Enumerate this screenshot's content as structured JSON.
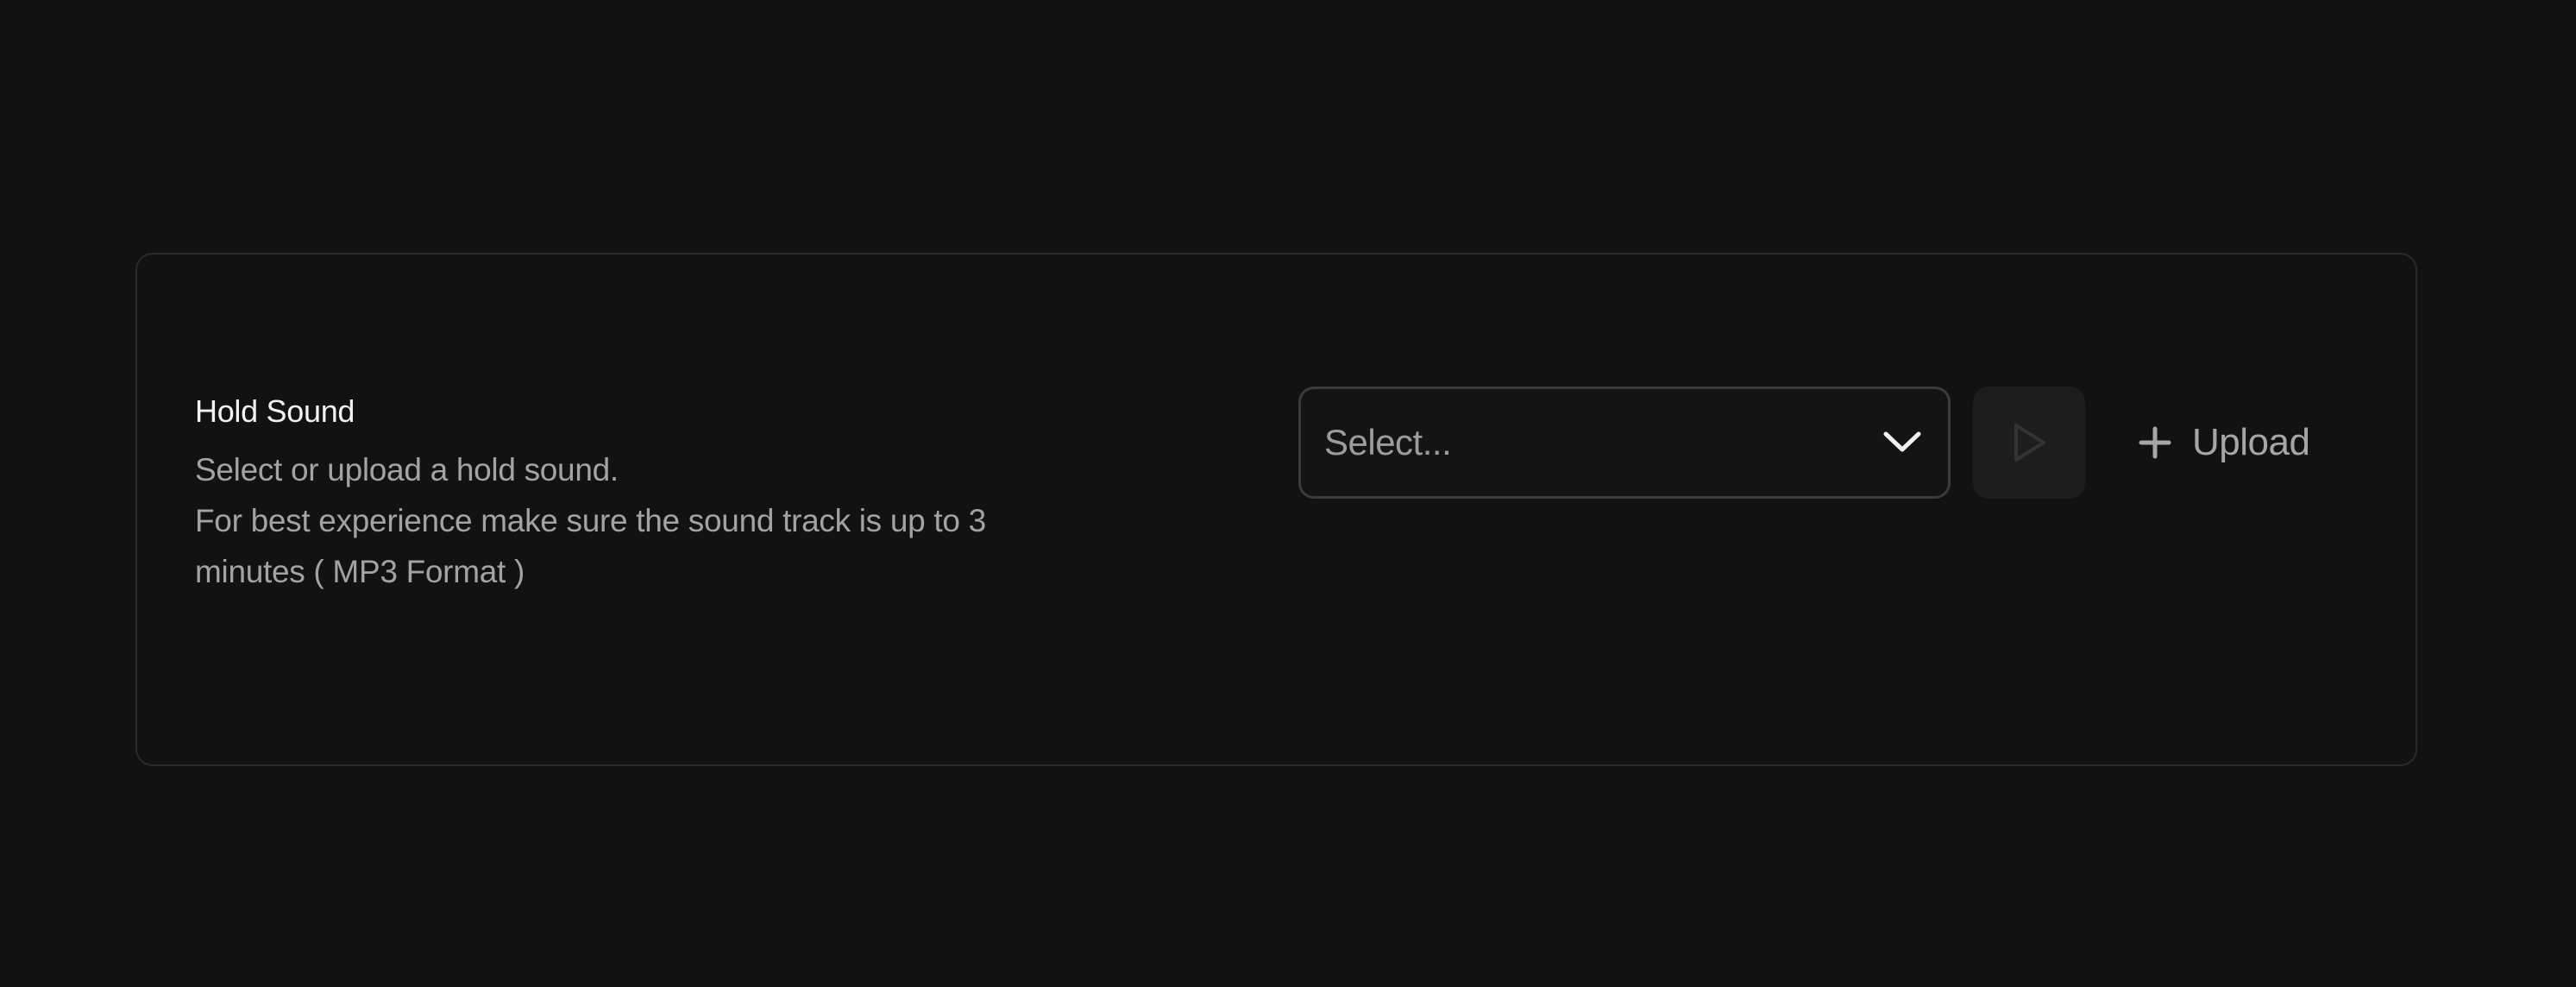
{
  "hold_sound": {
    "title": "Hold Sound",
    "description_lines": [
      "Select or upload a hold sound.",
      "For best experience make sure the sound track is up to 3",
      "minutes ( MP3 Format )"
    ],
    "select": {
      "placeholder": "Select...",
      "icon": "chevron-down-icon"
    },
    "play": {
      "icon": "play-icon",
      "disabled": true
    },
    "upload": {
      "label": "Upload",
      "icon": "plus-icon"
    }
  },
  "colors": {
    "background": "#121212",
    "card_border": "#2a2a2a",
    "title_text": "#f2f2f2",
    "secondary_text": "#a3a3a3",
    "play_button_bg": "#1d1d1d"
  }
}
